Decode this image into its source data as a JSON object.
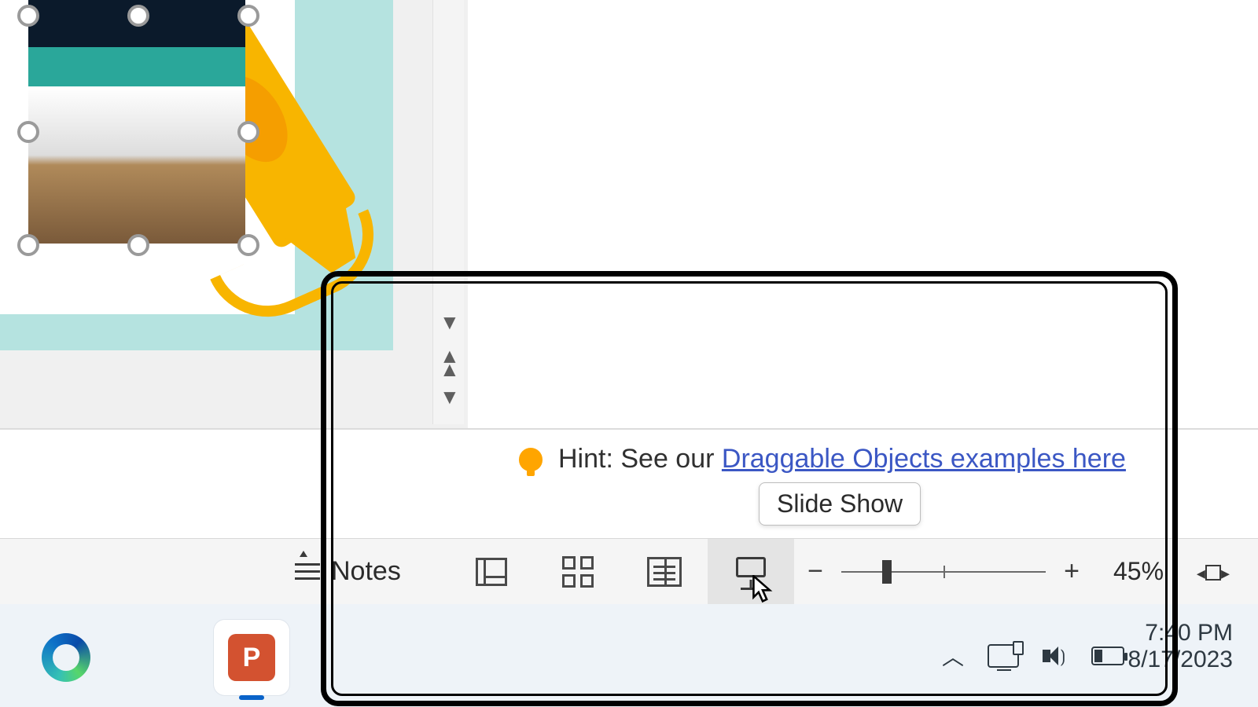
{
  "hint": {
    "prefix": "Hint: See our ",
    "link_text": "Draggable Objects examples here"
  },
  "tooltip": {
    "text": "Slide Show"
  },
  "statusbar": {
    "notes_label": "Notes",
    "zoom_percent": "45%"
  },
  "taskbar": {
    "ppt_letter": "P",
    "clock_time": "7:40 PM",
    "clock_date": "8/17/2023"
  }
}
